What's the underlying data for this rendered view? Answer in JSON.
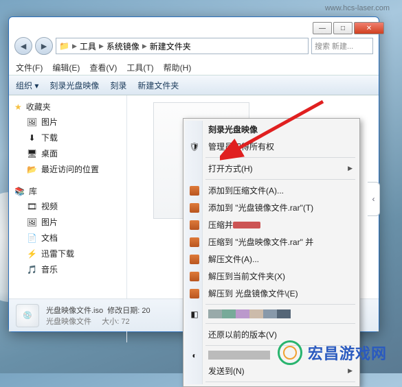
{
  "watermark_url": "www.hcs-laser.com",
  "titlebar": {
    "min": "—",
    "max": "□",
    "close": "✕"
  },
  "address": {
    "seg1": "工具",
    "seg2": "系统镜像",
    "seg3": "新建文件夹"
  },
  "searchbox": {
    "placeholder": "搜索 新建..."
  },
  "menubar": {
    "file": "文件(F)",
    "edit": "编辑(E)",
    "view": "查看(V)",
    "tools": "工具(T)",
    "help": "帮助(H)"
  },
  "toolbar": {
    "organize": "组织 ▾",
    "burn": "刻录光盘映像",
    "burn2": "刻录",
    "newfolder": "新建文件夹"
  },
  "sidebar": {
    "favorites_head": "收藏夹",
    "favorites": {
      "pictures": "图片",
      "downloads": "下载",
      "desktop": "桌面",
      "recent": "最近访问的位置"
    },
    "libraries_head": "库",
    "libraries": {
      "videos": "视频",
      "pictures": "图片",
      "documents": "文档",
      "thunder": "迅雷下载",
      "music": "音乐"
    }
  },
  "status": {
    "filename": "光盘映像文件.iso",
    "filetype": "光盘映像文件",
    "moddate_label": "修改日期:",
    "moddate_val": "20",
    "size_label": "大小:",
    "size_val": "72"
  },
  "context": {
    "burn": "刻录光盘映像",
    "admin": "管理员取得所有权",
    "openwith": "打开方式(H)",
    "addarchive": "添加到压缩文件(A)...",
    "addrar": "添加到 \"光盘镜像文件.rar\"(T)",
    "compressand": "压缩并 ",
    "compressrar": "压缩到 \"光盘映像文件.rar\" 并",
    "extract": "解压文件(A)...",
    "extracthere": "解压到当前文件夹(X)",
    "extractto": "解压到 光盘镜像文件\\(E)",
    "restore": "还原以前的版本(V)",
    "sendto": "发送到(N)"
  },
  "logo_text": "宏昌游戏网"
}
